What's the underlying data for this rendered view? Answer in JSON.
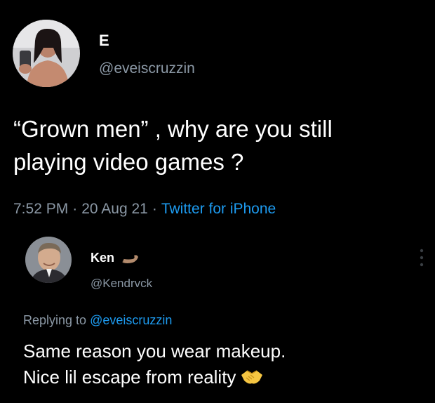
{
  "main_tweet": {
    "display_name": "E",
    "handle": "@eveiscruzzin",
    "text_line1": "“Grown men” , why are you still",
    "text_line2": "playing video games ?",
    "time": "7:52 PM",
    "date": "20 Aug 21",
    "separator": "·",
    "source": "Twitter for iPhone",
    "avatar_icon": "profile-photo"
  },
  "reply_tweet": {
    "display_name": "Ken",
    "name_emoji": "flexed-arm-icon",
    "handle": "@Kendrvck",
    "replying_prefix": "Replying to",
    "replying_to": "@eveiscruzzin",
    "text_line1": "Same reason you wear makeup.",
    "text_line2": "Nice lil escape from reality",
    "trailing_emoji": "handshake-icon",
    "avatar_icon": "profile-photo",
    "menu_icon": "more-vertical-icon"
  },
  "colors": {
    "background": "#000000",
    "text_primary": "#ffffff",
    "text_secondary": "#8b98a5",
    "accent": "#1d9bf0"
  }
}
